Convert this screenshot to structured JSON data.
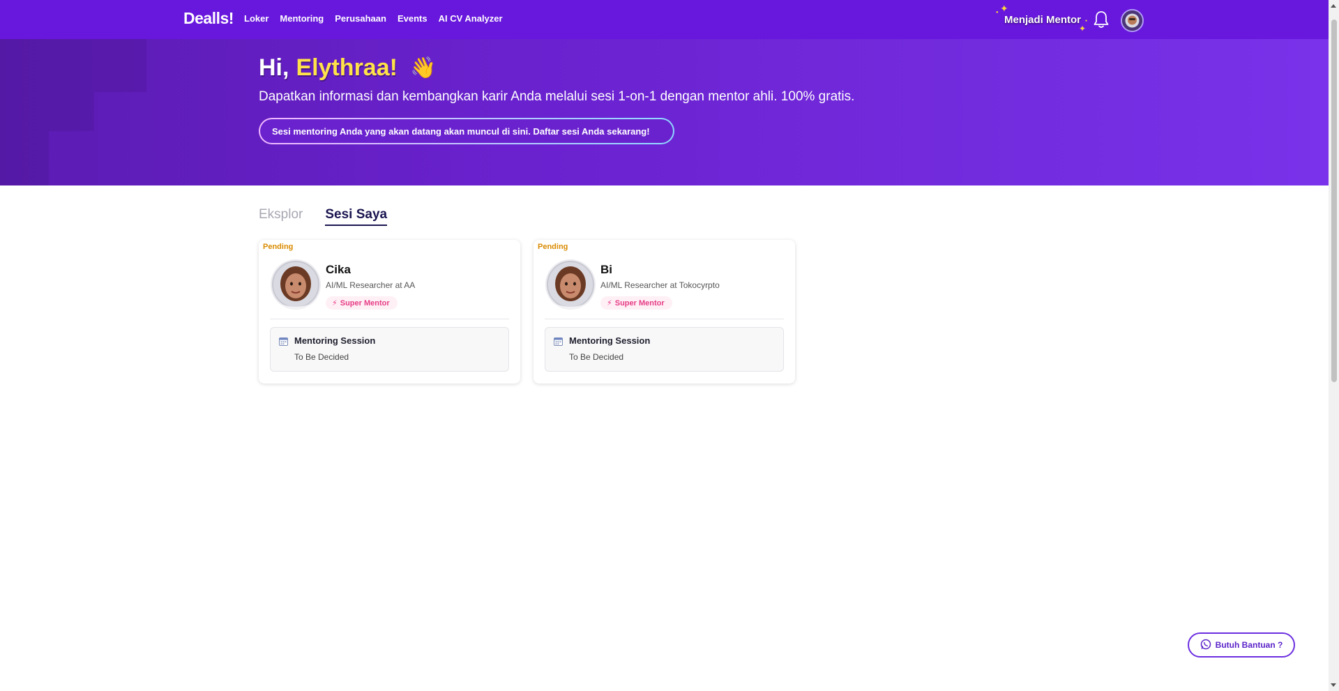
{
  "nav": {
    "logo": "Dealls!",
    "links": [
      "Loker",
      "Mentoring",
      "Perusahaan",
      "Events",
      "AI CV Analyzer"
    ],
    "become_mentor": "Menjadi Mentor",
    "notification_icon": "bell-icon",
    "avatar_icon": "user-avatar-icon"
  },
  "hero": {
    "greeting_hi": "Hi,",
    "greeting_name": "Elythraa!",
    "wave_emoji": "👋",
    "subtitle": "Dapatkan informasi dan kembangkan karir Anda melalui sesi 1-on-1 dengan mentor ahli. 100% gratis.",
    "upcoming_notice": "Sesi mentoring Anda yang akan datang akan muncul di sini. Daftar sesi Anda sekarang!"
  },
  "tabs": [
    {
      "label": "Eksplor",
      "active": false
    },
    {
      "label": "Sesi Saya",
      "active": true
    }
  ],
  "sessions": [
    {
      "status": "Pending",
      "name": "Cika",
      "role": "AI/ML Researcher at AA",
      "badge": "Super Mentor",
      "session_title": "Mentoring Session",
      "session_time": "To Be Decided"
    },
    {
      "status": "Pending",
      "name": "Bi",
      "role": "AI/ML Researcher at Tokocyrpto",
      "badge": "Super Mentor",
      "session_title": "Mentoring Session",
      "session_time": "To Be Decided"
    }
  ],
  "help": {
    "label": "Butuh Bantuan ?",
    "icon": "whatsapp-icon"
  },
  "colors": {
    "brand": "#6817dd",
    "highlight_name": "#ffe24a",
    "pending": "#d98a00",
    "super_badge": "#e63d86"
  }
}
